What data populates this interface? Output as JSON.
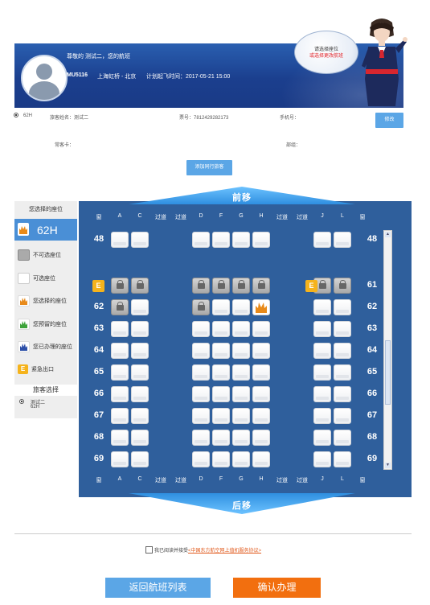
{
  "banner": {
    "greeting": "尊敬的 测试二，您的航班",
    "flight_no": "MU5116",
    "route": "上海虹桥 - 北京",
    "departure_label": "计划起飞时间：2017-05-21 15:00",
    "bubble_line1": "请选择座位",
    "bubble_line2": "或选择更改航班"
  },
  "passenger": {
    "seat": "62H",
    "name_label": "旅客姓名：测试二",
    "ticket_label": "票号：7812429282173",
    "phone_label": "手机号：",
    "edit_button": "修改",
    "frequent_card_label": "常客卡：",
    "dept_label": "部组：",
    "add_companion_button": "添加同行旅客"
  },
  "seatmap": {
    "front_label": "前移",
    "back_label": "后移",
    "selected_title": "您选择的座位",
    "selected_seat": "62H",
    "legend": [
      {
        "icon": "locked-seat-icon",
        "label": "不可选座位"
      },
      {
        "icon": "available-seat-icon",
        "label": "可选座位"
      },
      {
        "icon": "selected-seat-icon",
        "label": "您选择的座位"
      },
      {
        "icon": "seat-taken-by-you-icon",
        "label": "您预留的座位"
      },
      {
        "icon": "seat-companion-icon",
        "label": "您已办理的座位"
      },
      {
        "icon": "exit-icon",
        "label": "紧急出口"
      }
    ],
    "passenger_select_title": "旅客选择",
    "passenger_option_name": "测试二",
    "passenger_option_seat": "62H",
    "columns": [
      "窗",
      "A",
      "C",
      "过道",
      "过道",
      "D",
      "F",
      "G",
      "H",
      "过道",
      "过道",
      "J",
      "L",
      "窗"
    ],
    "rows": [
      "48",
      "61",
      "62",
      "63",
      "64",
      "65",
      "66",
      "67",
      "68",
      "69"
    ],
    "exit_label": "E",
    "colors": {
      "map_bg": "#2f5f9c",
      "accent": "#4a8fd6",
      "exit": "#f5b31c",
      "selected": "#e88a1a"
    }
  },
  "agreement": {
    "prefix": "我已阅读并接受",
    "link": "<中国东方航空网上值机服务协议>"
  },
  "actions": {
    "back_button": "返回航班列表",
    "confirm_button": "确认办理"
  }
}
